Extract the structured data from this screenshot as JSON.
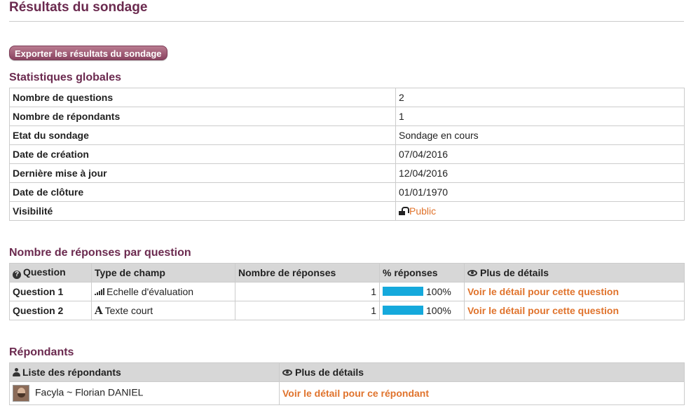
{
  "page": {
    "title": "Résultats du sondage"
  },
  "export_button": {
    "label": "Exporter les résultats du sondage"
  },
  "stats": {
    "title": "Statistiques globales",
    "rows": [
      {
        "label": "Nombre de questions",
        "value": "2"
      },
      {
        "label": "Nombre de répondants",
        "value": "1"
      },
      {
        "label": "Etat du sondage",
        "value": "Sondage en cours"
      },
      {
        "label": "Date de création",
        "value": "07/04/2016"
      },
      {
        "label": "Dernière mise à jour",
        "value": "12/04/2016"
      },
      {
        "label": "Date de clôture",
        "value": "01/01/1970"
      },
      {
        "label": "Visibilité",
        "value": "Public",
        "icon": "unlock-icon"
      }
    ]
  },
  "questions": {
    "title": "Nombre de réponses par question",
    "headers": {
      "question": "Question",
      "type": "Type de champ",
      "count": "Nombre de réponses",
      "percent": "% réponses",
      "details": "Plus de détails"
    },
    "rows": [
      {
        "name": "Question 1",
        "type": "Echelle d'évaluation",
        "type_icon": "signal-icon",
        "count": "1",
        "percent_label": "100%",
        "percent": 100,
        "details": "Voir le détail pour cette question"
      },
      {
        "name": "Question 2",
        "type": "Texte court",
        "type_icon": "font-icon",
        "count": "1",
        "percent_label": "100%",
        "percent": 100,
        "details": "Voir le détail pour cette question"
      }
    ]
  },
  "respondents": {
    "title": "Répondants",
    "headers": {
      "list": "Liste des répondants",
      "details": "Plus de détails"
    },
    "rows": [
      {
        "name": "Facyla ~ Florian DANIEL",
        "details": "Voir le détail pour ce répondant"
      }
    ]
  },
  "colors": {
    "accent_title": "#6b2a4f",
    "link": "#e0732c",
    "bar": "#15a9dc",
    "header_bg": "#d7d7d7"
  }
}
